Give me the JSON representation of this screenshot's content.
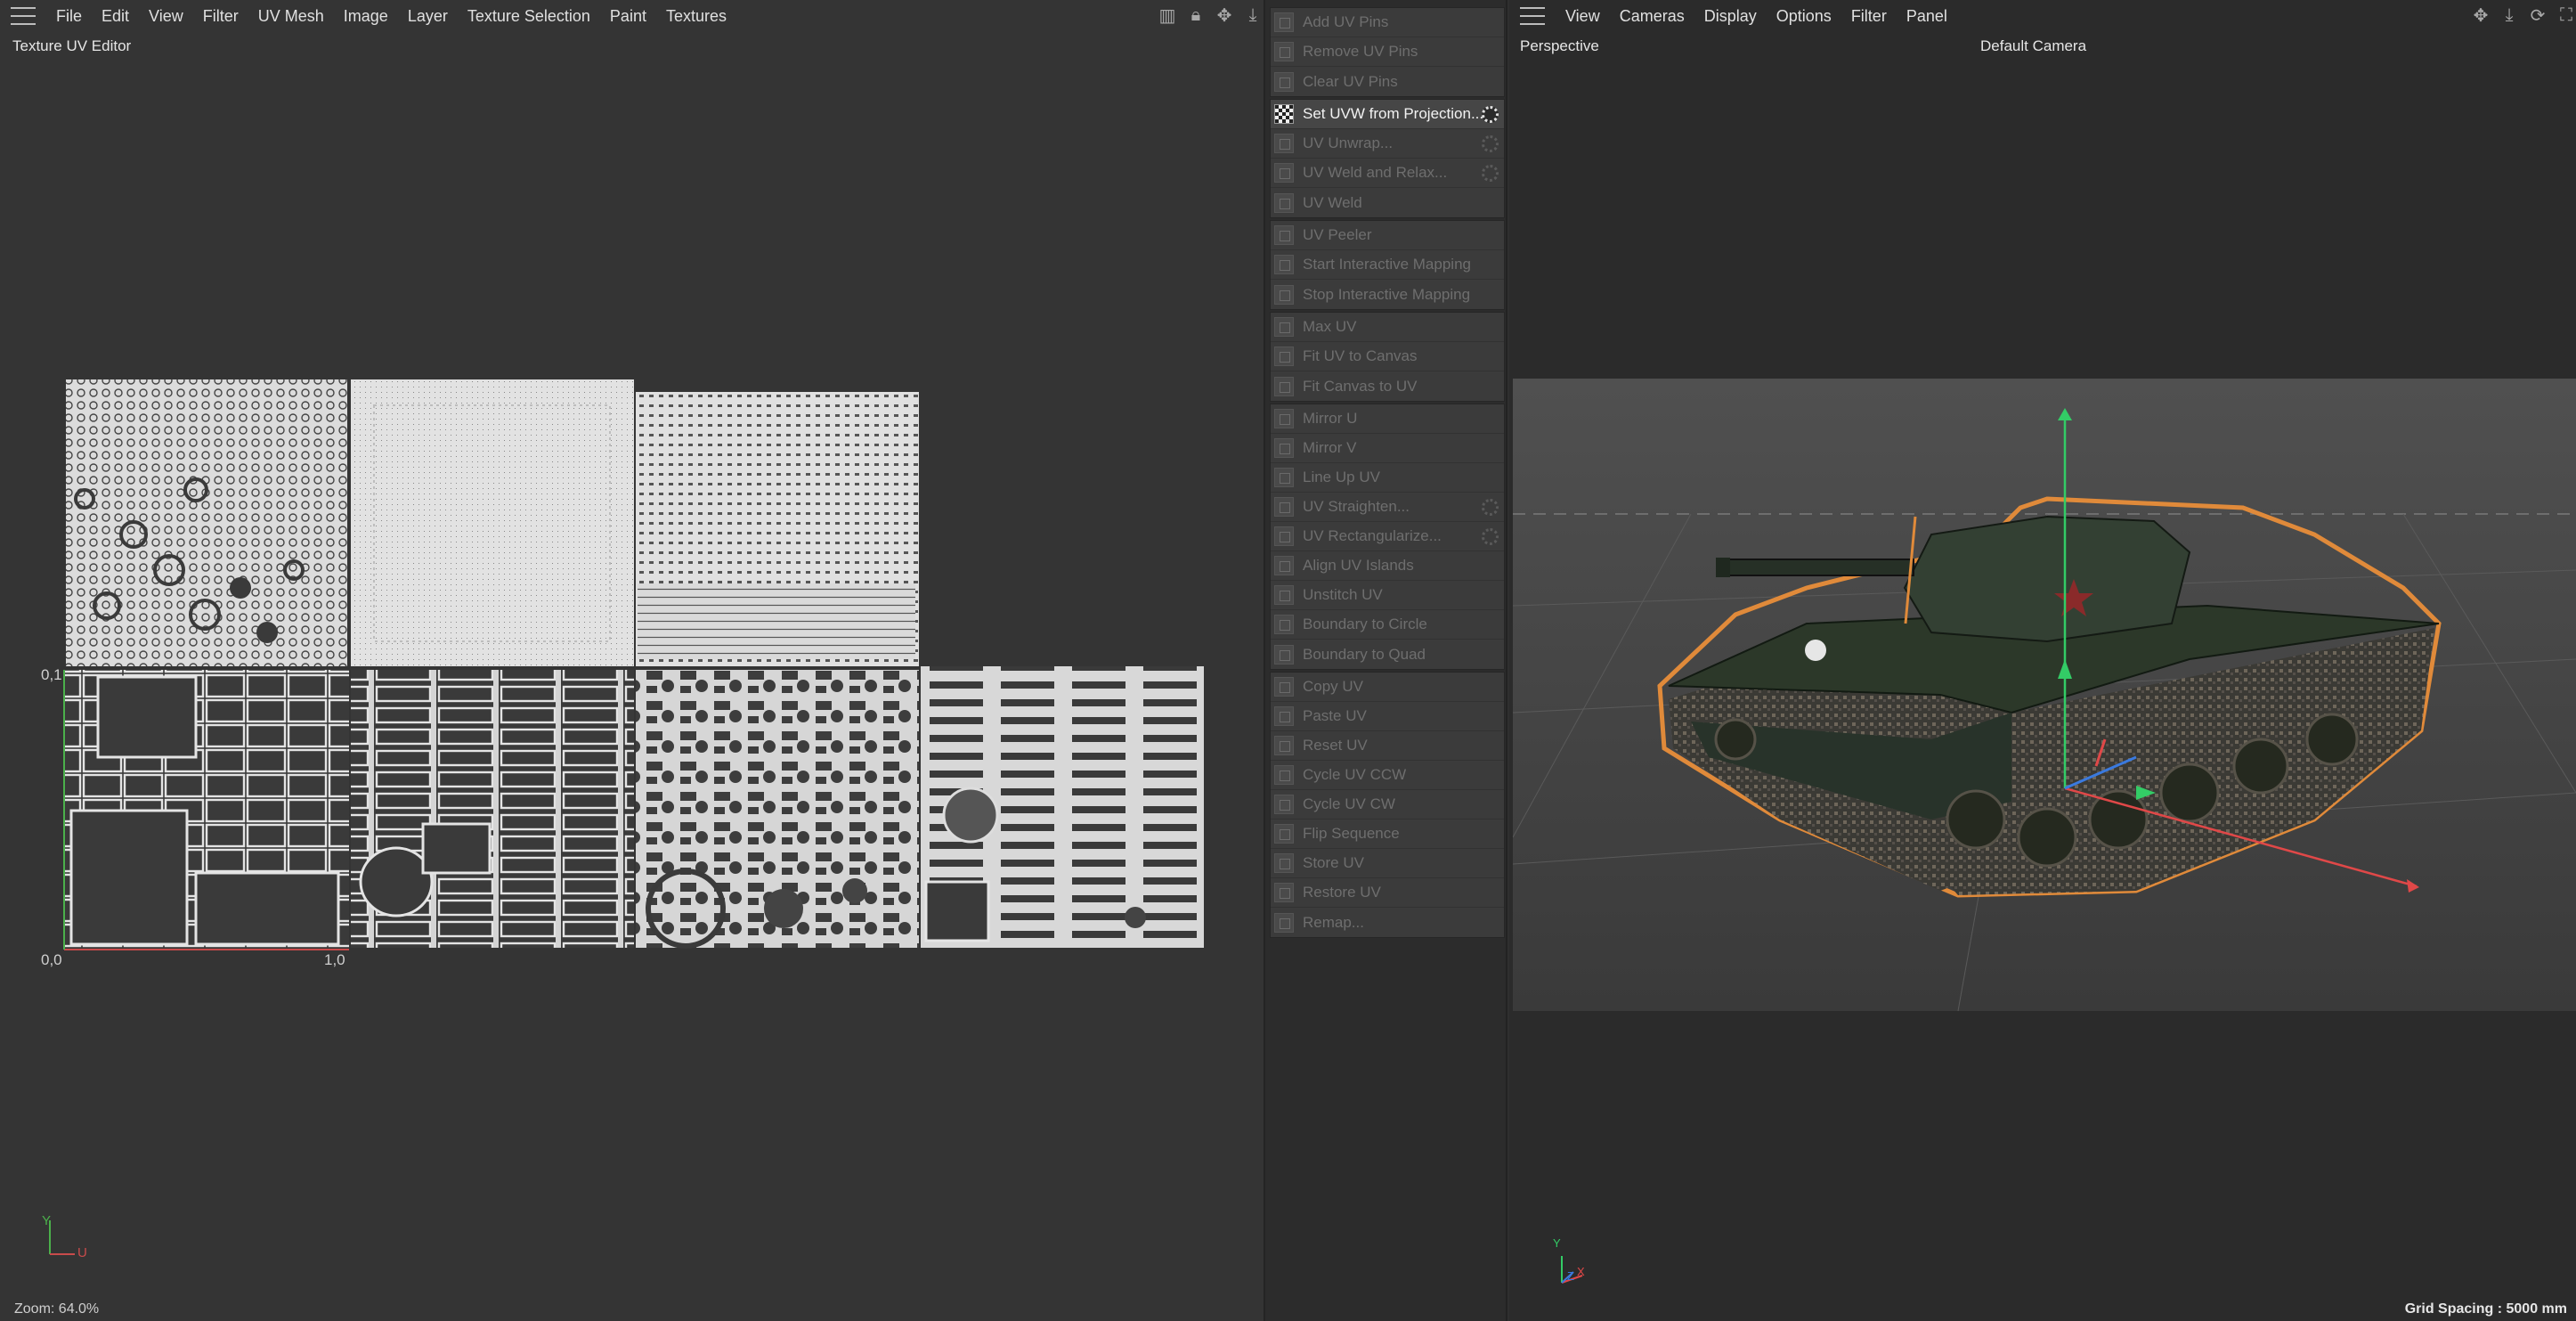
{
  "uv_editor": {
    "menu": [
      "File",
      "Edit",
      "View",
      "Filter",
      "UV Mesh",
      "Image",
      "Layer",
      "Texture Selection",
      "Paint",
      "Textures"
    ],
    "title": "Texture UV Editor",
    "labels": {
      "v_one": "0,1",
      "origin": "0,0",
      "u_one": "1,0"
    },
    "axis": {
      "y": "Y",
      "u": "U"
    },
    "zoom": "Zoom: 64.0%",
    "nav_icons": [
      "bar-chart-icon",
      "lock-icon",
      "move-icon",
      "pan-down-icon"
    ]
  },
  "palette": {
    "groups": [
      [
        {
          "label": "Add UV Pins",
          "enabled": false,
          "gear": false
        },
        {
          "label": "Remove UV Pins",
          "enabled": false,
          "gear": false
        },
        {
          "label": "Clear UV Pins",
          "enabled": false,
          "gear": false
        }
      ],
      [
        {
          "label": "Set UVW from Projection...",
          "enabled": true,
          "gear": true
        },
        {
          "label": "UV Unwrap...",
          "enabled": false,
          "gear": true
        },
        {
          "label": "UV Weld and Relax...",
          "enabled": false,
          "gear": true
        },
        {
          "label": "UV Weld",
          "enabled": false,
          "gear": false
        }
      ],
      [
        {
          "label": "UV Peeler",
          "enabled": false,
          "gear": false
        },
        {
          "label": "Start Interactive Mapping",
          "enabled": false,
          "gear": false
        },
        {
          "label": "Stop Interactive Mapping",
          "enabled": false,
          "gear": false
        }
      ],
      [
        {
          "label": "Max UV",
          "enabled": false,
          "gear": false
        },
        {
          "label": "Fit UV to Canvas",
          "enabled": false,
          "gear": false
        },
        {
          "label": "Fit Canvas to UV",
          "enabled": false,
          "gear": false
        }
      ],
      [
        {
          "label": "Mirror U",
          "enabled": false,
          "gear": false
        },
        {
          "label": "Mirror V",
          "enabled": false,
          "gear": false
        },
        {
          "label": "Line Up UV",
          "enabled": false,
          "gear": false
        },
        {
          "label": "UV Straighten...",
          "enabled": false,
          "gear": true
        },
        {
          "label": "UV Rectangularize...",
          "enabled": false,
          "gear": true
        },
        {
          "label": "Align UV Islands",
          "enabled": false,
          "gear": false
        },
        {
          "label": "Unstitch UV",
          "enabled": false,
          "gear": false
        },
        {
          "label": "Boundary to Circle",
          "enabled": false,
          "gear": false
        },
        {
          "label": "Boundary to Quad",
          "enabled": false,
          "gear": false
        }
      ],
      [
        {
          "label": "Copy UV",
          "enabled": false,
          "gear": false
        },
        {
          "label": "Paste UV",
          "enabled": false,
          "gear": false
        },
        {
          "label": "Reset UV",
          "enabled": false,
          "gear": false
        },
        {
          "label": "Cycle UV CCW",
          "enabled": false,
          "gear": false
        },
        {
          "label": "Cycle UV CW",
          "enabled": false,
          "gear": false
        },
        {
          "label": "Flip Sequence",
          "enabled": false,
          "gear": false
        },
        {
          "label": "Store UV",
          "enabled": false,
          "gear": false
        },
        {
          "label": "Restore UV",
          "enabled": false,
          "gear": false
        },
        {
          "label": "Remap...",
          "enabled": false,
          "gear": false
        }
      ]
    ]
  },
  "viewport": {
    "menu": [
      "View",
      "Cameras",
      "Display",
      "Options",
      "Filter",
      "Panel"
    ],
    "view_name": "Perspective",
    "camera": "Default Camera",
    "grid_spacing": "Grid Spacing : 5000 mm",
    "axis": {
      "y": "Y",
      "x": "X",
      "z": "Z"
    },
    "nav_icons": [
      "move-icon",
      "pan-down-icon",
      "rotate-icon",
      "maximize-icon"
    ]
  },
  "colors": {
    "selection_outline": "#e08a3a",
    "axis_y": "#33cc66",
    "axis_x": "#e04848",
    "axis_z": "#3a7adf",
    "tank": "#2d3a2a",
    "uv_fill": "#d4d4d4"
  }
}
